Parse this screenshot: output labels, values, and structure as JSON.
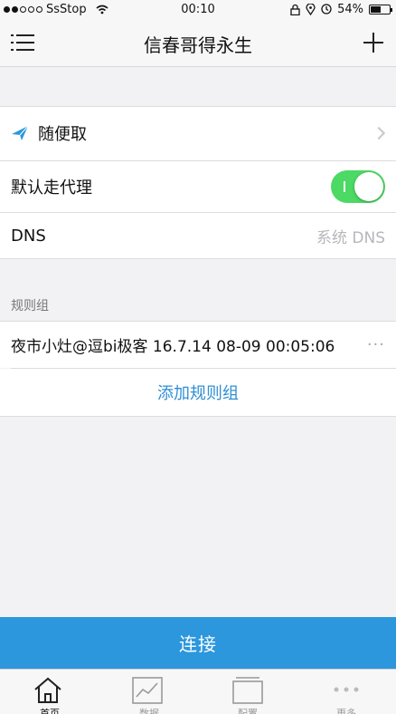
{
  "status_bar": {
    "carrier": "SsStop",
    "time": "00:10",
    "battery": "54%",
    "battery_level": 0.54
  },
  "nav": {
    "title": "信春哥得永生"
  },
  "rows": {
    "proxy_name": "随便取",
    "default_proxy_label": "默认走代理",
    "default_proxy_on": true,
    "dns_label": "DNS",
    "dns_value": "系统 DNS"
  },
  "rules": {
    "section_title": "规则组",
    "item_label": "夜市小灶@逗bi极客 16.7.14 08-09 00:05:06",
    "more": "···",
    "add_label": "添加规则组"
  },
  "connect_label": "连接",
  "tabs": [
    {
      "label": "首页",
      "icon": "home-icon",
      "active": true
    },
    {
      "label": "数据",
      "icon": "chart-icon",
      "active": false
    },
    {
      "label": "配置",
      "icon": "config-icon",
      "active": false
    },
    {
      "label": "更多",
      "icon": "more-icon",
      "active": false
    }
  ],
  "colors": {
    "accent": "#2c97dc",
    "toggle_on": "#4cd964",
    "link": "#2f8fd4"
  }
}
